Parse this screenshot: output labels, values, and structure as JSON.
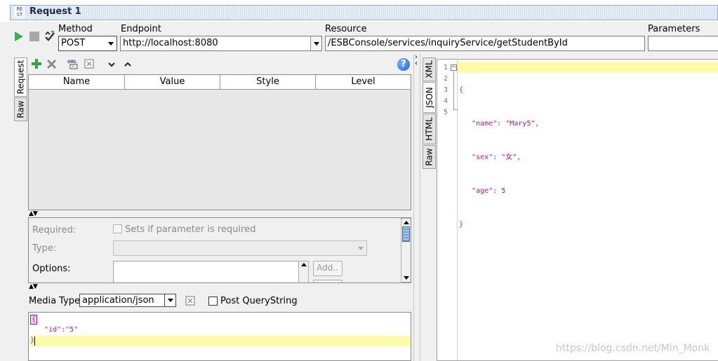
{
  "window": {
    "title": "Request 1",
    "rest_icon_text": "RE\nST"
  },
  "toolbar": {
    "method_label": "Method",
    "method_value": "POST",
    "endpoint_label": "Endpoint",
    "endpoint_value": "http://localhost:8080",
    "resource_label": "Resource",
    "resource_value": "/ESBConsole/services/inquiryService/getStudentById",
    "parameters_label": "Parameters"
  },
  "left_tabs": {
    "request": "Request",
    "raw": "Raw"
  },
  "param_toolbar": {
    "help": "?"
  },
  "params_table": {
    "columns": [
      "Name",
      "Value",
      "Style",
      "Level"
    ]
  },
  "param_details": {
    "required_label": "Required:",
    "required_checkbox_label": "Sets if parameter is required",
    "type_label": "Type:",
    "options_label": "Options:",
    "add_button": "Add.."
  },
  "media": {
    "label": "Media Type",
    "value": "application/json",
    "post_querystring_label": "Post QueryString"
  },
  "request_body": {
    "lines": [
      "{",
      "   \"id\":\"5\"",
      "}"
    ]
  },
  "right_tabs": {
    "xml": "XML",
    "json": "JSON",
    "html": "HTML",
    "raw": "Raw"
  },
  "response": {
    "line_numbers": [
      "1",
      "2",
      "3",
      "4",
      "5"
    ],
    "lines": [
      "{",
      "   \"name\": \"Mary5\",",
      "   \"sex\": \"女\",",
      "   \"age\": 5",
      "}"
    ]
  },
  "watermark": "https://blog.csdn.net/Min_Monk",
  "colors": {
    "accent_green": "#3ab34a",
    "json_key": "#b0188f",
    "current_line": "#fffbaa",
    "title_text": "#1a2a55"
  }
}
